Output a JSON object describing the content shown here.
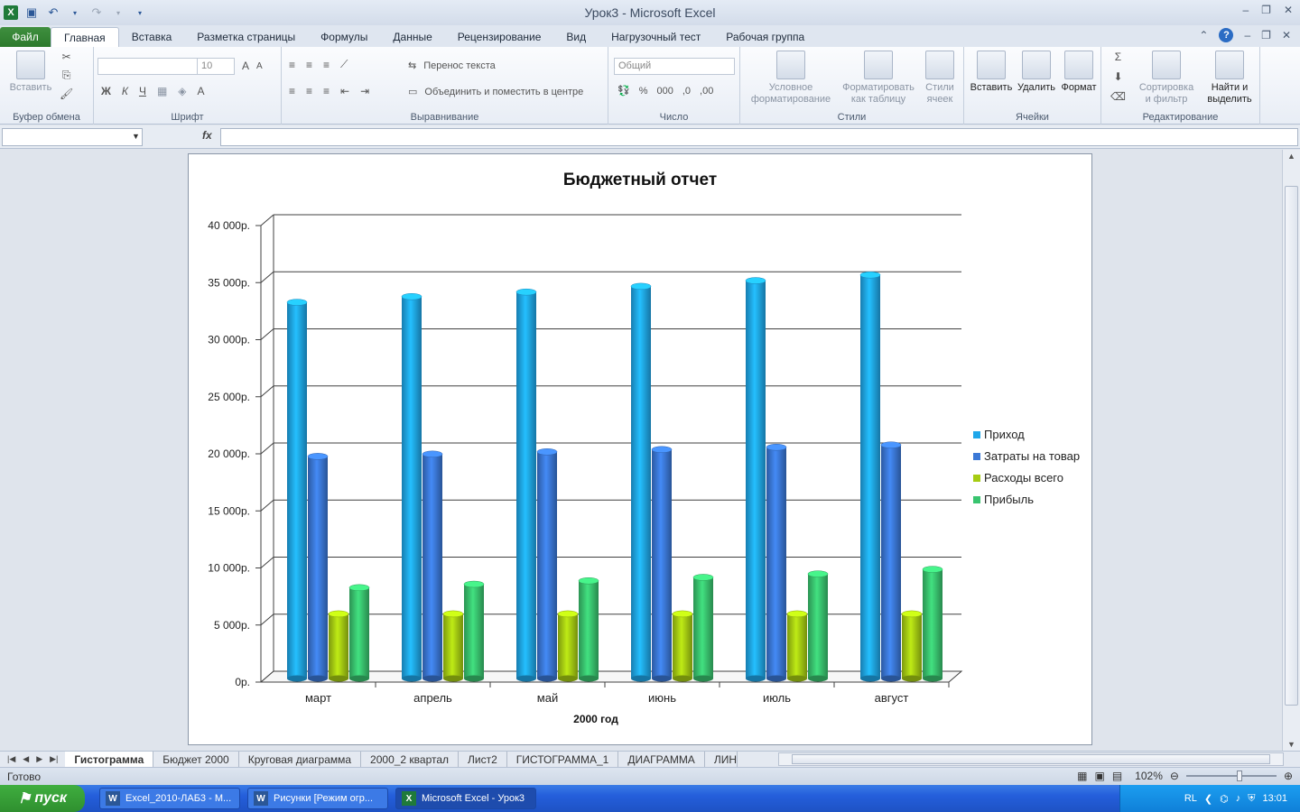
{
  "window": {
    "title": "Урок3  -  Microsoft Excel",
    "ctl_min": "–",
    "ctl_max": "❐",
    "ctl_close": "✕"
  },
  "qat": {
    "logo": "X",
    "save_icon": "floppy-icon",
    "undo_icon": "undo-icon",
    "redo_icon": "redo-icon"
  },
  "tabs": [
    "Файл",
    "Главная",
    "Вставка",
    "Разметка страницы",
    "Формулы",
    "Данные",
    "Рецензирование",
    "Вид",
    "Нагрузочный тест",
    "Рабочая группа"
  ],
  "ribbon": {
    "clipboard": {
      "paste": "Вставить",
      "label": "Буфер обмена"
    },
    "font": {
      "size": "10",
      "bold": "Ж",
      "italic": "К",
      "underline": "Ч",
      "grow": "A",
      "shrink": "A",
      "color": "A",
      "label": "Шрифт"
    },
    "alignment": {
      "wrap": "Перенос текста",
      "merge": "Объединить и поместить в центре",
      "label": "Выравнивание"
    },
    "number": {
      "format": "Общий",
      "percent": "%",
      "thousands": "000",
      "inc": ",0",
      "dec": ",00",
      "label": "Число"
    },
    "styles": {
      "conditional_1": "Условное",
      "conditional_2": "форматирование",
      "table_1": "Форматировать",
      "table_2": "как таблицу",
      "cell_1": "Стили",
      "cell_2": "ячеек",
      "label": "Стили"
    },
    "cells": {
      "insert": "Вставить",
      "delete": "Удалить",
      "format": "Формат",
      "label": "Ячейки"
    },
    "editing": {
      "sigma": "Σ",
      "sort_1": "Сортировка",
      "sort_2": "и фильтр",
      "find_1": "Найти и",
      "find_2": "выделить",
      "label": "Редактирование"
    }
  },
  "formula": {
    "fx": "fx",
    "name_value": "",
    "formula_value": ""
  },
  "chart_data": {
    "type": "bar",
    "title": "Бюджетный  отчет",
    "xlabel": "2000 год",
    "ylabel": "",
    "categories": [
      "март",
      "апрель",
      "май",
      "июнь",
      "июль",
      "август"
    ],
    "ylim": [
      0,
      40000
    ],
    "yticks": [
      "0р.",
      "5 000р.",
      "10 000р.",
      "15 000р.",
      "20 000р.",
      "25 000р.",
      "30 000р.",
      "35 000р.",
      "40 000р."
    ],
    "grid": true,
    "legend_position": "right",
    "series": [
      {
        "name": "Приход",
        "color": "#1fa7ea",
        "values": [
          32800,
          33300,
          33700,
          34200,
          34700,
          35200
        ]
      },
      {
        "name": "Затраты на товар",
        "color": "#3b78d6",
        "values": [
          19300,
          19500,
          19700,
          19900,
          20100,
          20300
        ]
      },
      {
        "name": "Расходы всего",
        "color": "#a6cc12",
        "values": [
          5500,
          5500,
          5500,
          5500,
          5500,
          5500
        ]
      },
      {
        "name": "Прибыль",
        "color": "#39c46f",
        "values": [
          7800,
          8100,
          8400,
          8700,
          9000,
          9400
        ]
      }
    ]
  },
  "sheets": [
    "Гистограмма",
    "Бюджет 2000",
    "Круговая диаграмма",
    "2000_2 квартал",
    "Лист2",
    "ГИСТОГРАММА_1",
    "ДИАГРАММА",
    "ЛИН"
  ],
  "status": {
    "ready": "Готово",
    "zoom": "102%"
  },
  "taskbar": {
    "start": "пуск",
    "items": [
      "Excel_2010-ЛАБ3 - M...",
      "Рисунки [Режим огр...",
      "Microsoft Excel - Урок3"
    ],
    "lang": "RL",
    "clock": "13:01"
  }
}
